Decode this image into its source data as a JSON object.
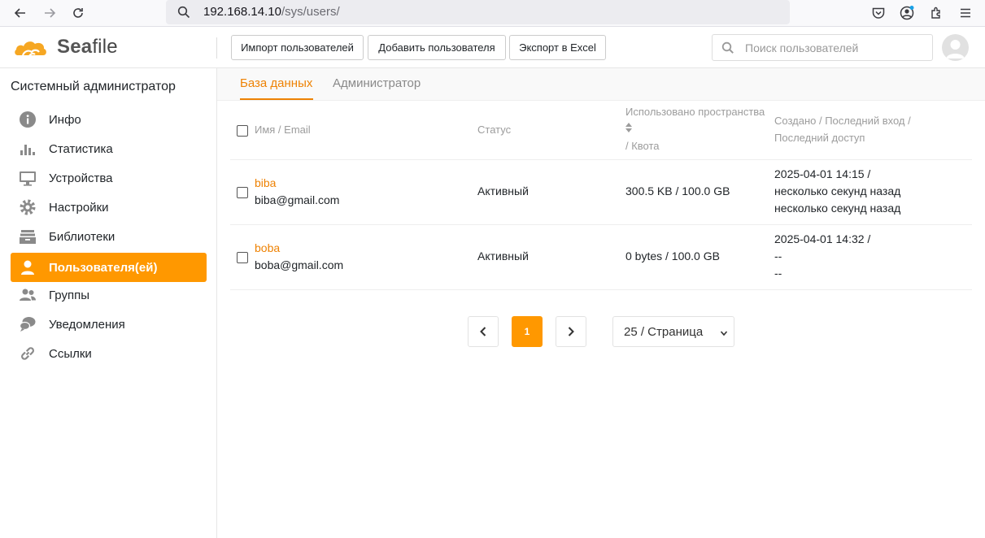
{
  "browser": {
    "url_host": "192.168.14.10",
    "url_path": "/sys/users/"
  },
  "header": {
    "logo_text_a": "Sea",
    "logo_text_b": "file",
    "import_label": "Импорт пользователей",
    "add_label": "Добавить пользователя",
    "export_label": "Экспорт в Excel",
    "search_placeholder": "Поиск пользователей"
  },
  "sidebar": {
    "title": "Системный администратор",
    "items": [
      {
        "label": "Инфо",
        "icon": "info-icon"
      },
      {
        "label": "Статистика",
        "icon": "bar-chart-icon"
      },
      {
        "label": "Устройства",
        "icon": "monitor-icon"
      },
      {
        "label": "Настройки",
        "icon": "gear-icon"
      },
      {
        "label": "Библиотеки",
        "icon": "library-icon"
      },
      {
        "label": "Пользователя(ей)",
        "icon": "user-icon",
        "active": true
      },
      {
        "label": "Группы",
        "icon": "group-icon"
      },
      {
        "label": "Уведомления",
        "icon": "notification-icon"
      },
      {
        "label": "Ссылки",
        "icon": "link-icon"
      }
    ]
  },
  "tabs": {
    "database": "База данных",
    "admin": "Администратор"
  },
  "table": {
    "col_name": "Имя / Email",
    "col_status": "Статус",
    "col_space_1": "Использовано пространства",
    "col_space_2": "/ Квота",
    "col_created_1": "Создано / Последний вход /",
    "col_created_2": "Последний доступ",
    "rows": [
      {
        "name": "biba",
        "email": "biba@gmail.com",
        "status": "Активный",
        "space": "300.5 KB / 100.0 GB",
        "created": "2025-04-01 14:15 /",
        "last_login": "несколько секунд назад",
        "last_access": "несколько секунд назад"
      },
      {
        "name": "boba",
        "email": "boba@gmail.com",
        "status": "Активный",
        "space": "0 bytes / 100.0 GB",
        "created": "2025-04-01 14:32 /",
        "last_login": "--",
        "last_access": "--"
      }
    ]
  },
  "pagination": {
    "current_page": "1",
    "per_page": "25 / Страница"
  },
  "colors": {
    "accent": "#ff9800",
    "link": "#ee8204"
  }
}
